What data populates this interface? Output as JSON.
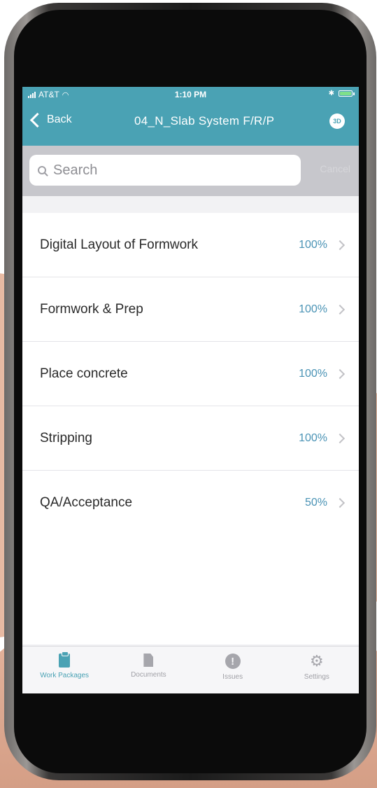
{
  "status_bar": {
    "carrier": "AT&T",
    "time": "1:10 PM"
  },
  "nav": {
    "back_label": "Back",
    "title": "04_N_Slab System F/R/P",
    "right_icon": "cube-3d-icon",
    "right_icon_text": "3D"
  },
  "search": {
    "placeholder": "Search",
    "cancel_label": "Cancel"
  },
  "work_items": [
    {
      "label": "Digital Layout of Formwork",
      "percent": "100%"
    },
    {
      "label": "Formwork & Prep",
      "percent": "100%"
    },
    {
      "label": "Place concrete",
      "percent": "100%"
    },
    {
      "label": "Stripping",
      "percent": "100%"
    },
    {
      "label": "QA/Acceptance",
      "percent": "50%"
    }
  ],
  "tabs": [
    {
      "label": "Work Packages",
      "icon": "clipboard-icon",
      "active": true
    },
    {
      "label": "Documents",
      "icon": "document-icon",
      "active": false
    },
    {
      "label": "Issues",
      "icon": "alert-icon",
      "active": false
    },
    {
      "label": "Settings",
      "icon": "gear-icon",
      "active": false
    }
  ],
  "colors": {
    "accent": "#4aa2b4",
    "percent_text": "#4a93b5"
  }
}
